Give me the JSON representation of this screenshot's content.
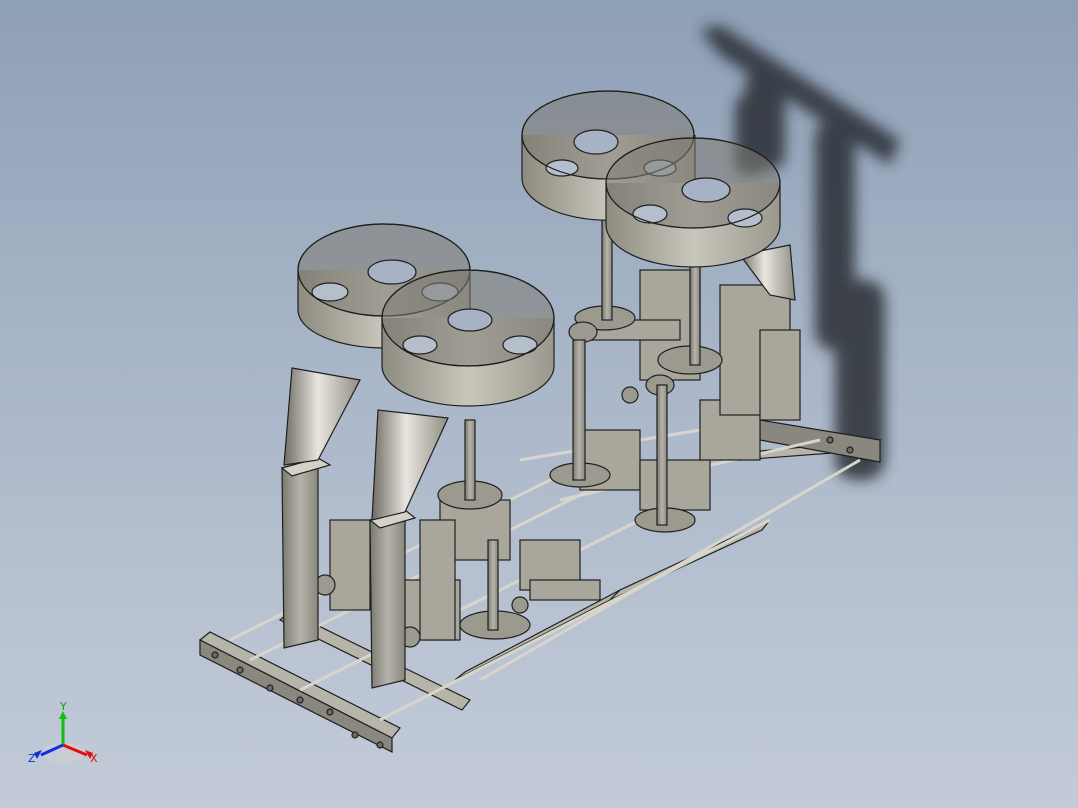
{
  "viewport": {
    "background_top": "#8e9fb6",
    "background_bottom": "#c3cbd8",
    "view": "isometric",
    "display_mode": "shaded-with-edges"
  },
  "model": {
    "hoppers": 4,
    "cones": 2,
    "part_color": "#bdbbb0",
    "edge_color": "#1f1f1f"
  },
  "triad": {
    "x_label": "X",
    "y_label": "Y",
    "z_label": "Z",
    "x_color": "#e01010",
    "y_color": "#10c010",
    "z_color": "#1030e0"
  }
}
